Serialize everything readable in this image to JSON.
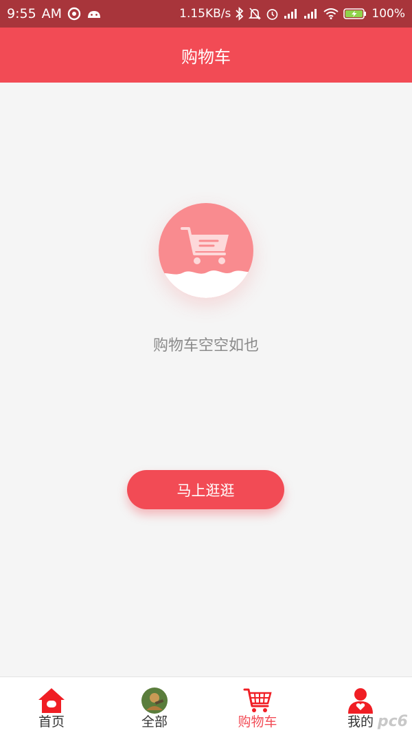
{
  "status_bar": {
    "time": "9:55",
    "ampm": "AM",
    "speed": "1.15KB/s",
    "battery": "100%"
  },
  "header": {
    "title": "购物车"
  },
  "empty_state": {
    "message": "购物车空空如也",
    "button_label": "马上逛逛"
  },
  "tabbar": {
    "tabs": [
      {
        "label": "首页",
        "icon": "home-icon",
        "active": false
      },
      {
        "label": "全部",
        "icon": "avatar-icon",
        "active": false
      },
      {
        "label": "购物车",
        "icon": "cart-icon",
        "active": true
      },
      {
        "label": "我的",
        "icon": "user-icon",
        "active": false
      }
    ]
  },
  "watermark": "pc6",
  "colors": {
    "accent": "#f24b55",
    "status_bar": "#a8353b",
    "background": "#f5f5f5",
    "empty_circle": "#f98b8f"
  }
}
